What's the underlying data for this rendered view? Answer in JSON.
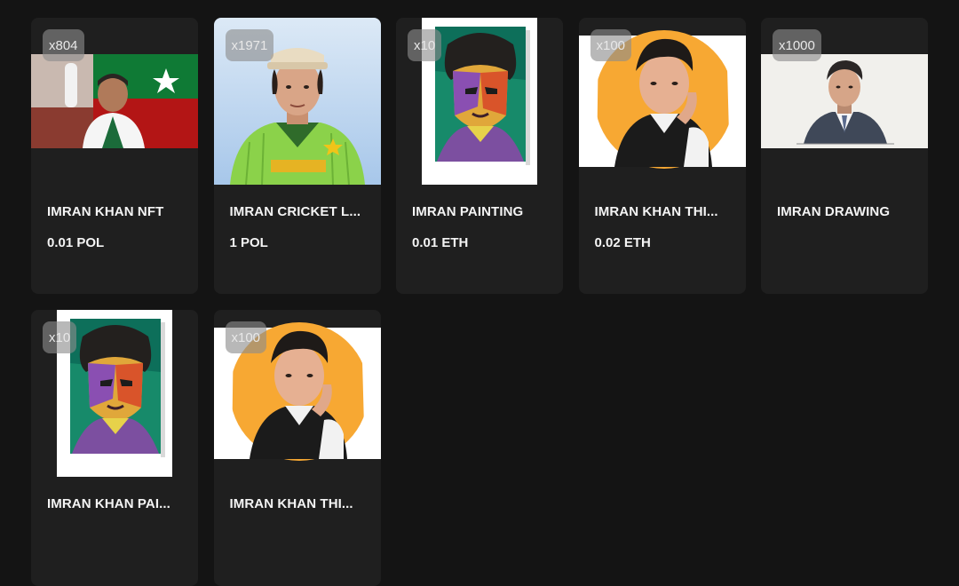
{
  "cards": [
    {
      "badge": "x804",
      "name": "IMRAN KHAN NFT",
      "price": "0.01 POL",
      "art": "flag-portrait"
    },
    {
      "badge": "x1971",
      "name": "IMRAN CRICKET L...",
      "price": "1 POL",
      "art": "cricket-portrait"
    },
    {
      "badge": "x10",
      "name": "IMRAN PAINTING",
      "price": "0.01 ETH",
      "art": "pop-art-portrait"
    },
    {
      "badge": "x100",
      "name": "IMRAN KHAN THI...",
      "price": "0.02 ETH",
      "art": "thinking-portrait"
    },
    {
      "badge": "x1000",
      "name": "IMRAN DRAWING",
      "price": "",
      "art": "sketch-portrait"
    },
    {
      "badge": "x10",
      "name": "IMRAN KHAN PAI...",
      "price": "",
      "art": "pop-art-portrait"
    },
    {
      "badge": "x100",
      "name": "IMRAN KHAN THI...",
      "price": "",
      "art": "thinking-portrait"
    }
  ]
}
